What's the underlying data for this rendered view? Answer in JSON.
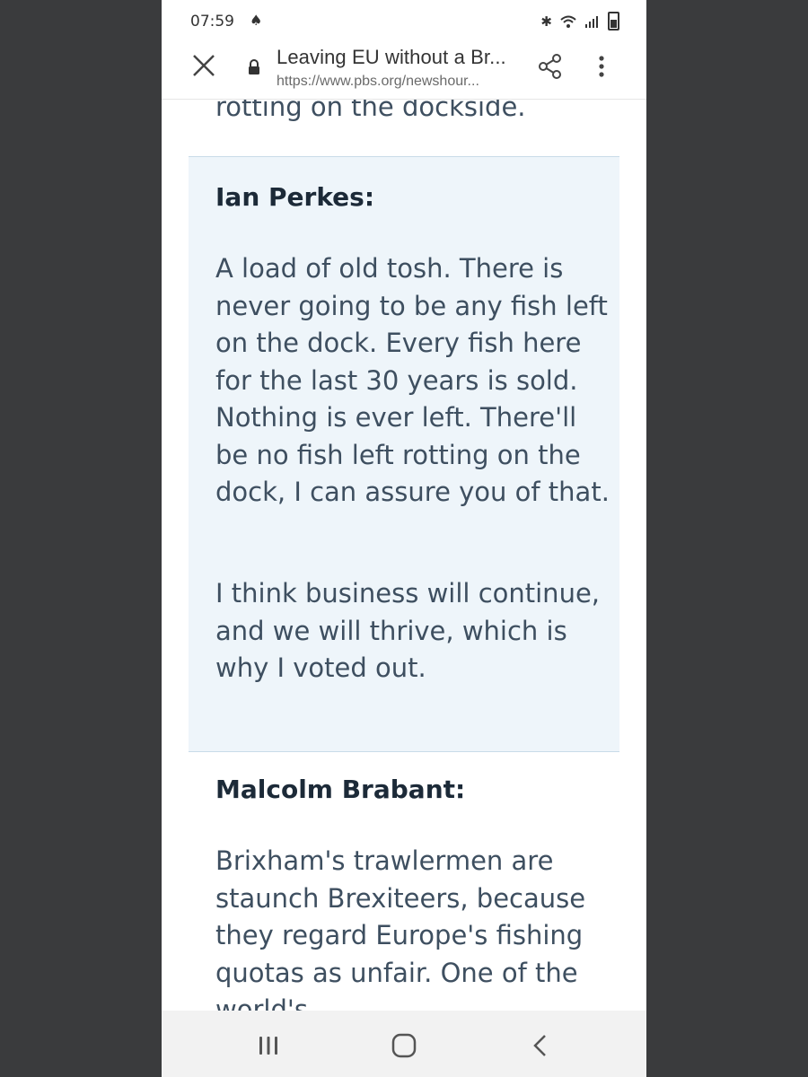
{
  "status_bar": {
    "time": "07:59",
    "notification_icon": "app-notification-icon",
    "icons": [
      "bluetooth-icon",
      "wifi-icon",
      "signal-icon",
      "battery-icon"
    ]
  },
  "browser": {
    "page_title": "Leaving EU without a Br...",
    "url": "https://www.pbs.org/newshour...",
    "close_icon": "close-icon",
    "lock_icon": "lock-icon",
    "share_icon": "share-icon",
    "menu_icon": "more-vert-icon"
  },
  "article": {
    "top_fragment": "rotting on the dockside.",
    "quote": {
      "speaker": "Ian Perkes:",
      "paragraphs": [
        "A load of old tosh. There is never going to be any fish left on the dock. Every fish here for the last 30 years is sold. Nothing is ever left. There'll be no fish left rotting on the dock, I can assure you of that.",
        "I think business will continue, and we will thrive, which is why I voted out."
      ]
    },
    "next_speaker": "Malcolm Brabant:",
    "next_paragraph": "Brixham's trawlermen are staunch Brexiteers, because they regard Europe's fishing quotas as unfair. One of the world's"
  },
  "colors": {
    "quote_background": "#eef5fa",
    "body_text": "#3e4f60",
    "speaker_text": "#1c2a38"
  },
  "nav_bar": {
    "icons": [
      "recents-icon",
      "home-icon",
      "back-icon"
    ]
  }
}
